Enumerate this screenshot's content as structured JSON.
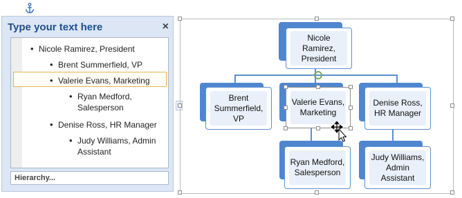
{
  "text_pane": {
    "title": "Type your text here",
    "close_glyph": "×",
    "items": [
      {
        "bullet": "•",
        "text": "Nicole Ramirez, President"
      },
      {
        "bullet": "•",
        "text": "Brent Summerfield, VP"
      },
      {
        "bullet": "•",
        "text": "Valerie Evans, Marketing"
      },
      {
        "bullet": "•",
        "text": "Ryan Medford, Salesperson"
      },
      {
        "bullet": "•",
        "text": "Denise Ross, HR Manager"
      },
      {
        "bullet": "•",
        "text": "Judy Williams, Admin Assistant"
      }
    ],
    "layout_name": "Hierarchy..."
  },
  "expander_glyph": "›",
  "chart": {
    "president": "Nicole Ramirez, President",
    "vp": "Brent Summerfield, VP",
    "marketing": "Valerie Evans, Marketing",
    "hr": "Denise Ross, HR Manager",
    "sales": "Ryan Medford, Salesperson",
    "admin": "Judy Williams, Admin Assistant"
  },
  "colors": {
    "accent": "#4f86cf",
    "selection": "#e8b44a",
    "title": "#1f4e8c"
  },
  "icons": [
    "anchor-icon",
    "close-icon",
    "move-cursor-icon",
    "rotate-handle-icon",
    "bullet-icon"
  ]
}
